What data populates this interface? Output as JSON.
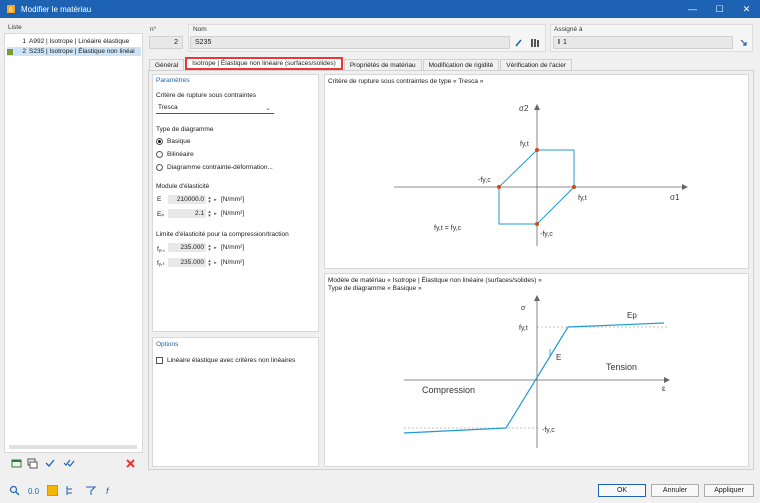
{
  "window": {
    "title": "Modifier le matériau",
    "minimize": "—",
    "maximize": "☐",
    "close": "✕"
  },
  "list": {
    "header": "Liste",
    "items": [
      {
        "num": "1",
        "label": "A992 | Isotrope | Linéaire élastique",
        "color": "#ffffff"
      },
      {
        "num": "2",
        "label": "S235 | Isotrope | Élastique non linéai",
        "color": "#7a9a3a"
      }
    ]
  },
  "header": {
    "num_label": "n°",
    "num_value": "2",
    "name_label": "Nom",
    "name_value": "S235",
    "assigned_label": "Assigné à",
    "assigned_value": "1"
  },
  "tabs": [
    {
      "label": "Général"
    },
    {
      "label": "Isotrope | Élastique non linéaire (surfaces/solides)"
    },
    {
      "label": "Propriétés de matériau"
    },
    {
      "label": "Modification de rigidité"
    },
    {
      "label": "Vérification de l'acier"
    }
  ],
  "params": {
    "title": "Paramètres",
    "criterion_label": "Critère de rupture sous contraintes",
    "criterion_value": "Tresca",
    "diagram_type_label": "Type de diagramme",
    "diagram_options": [
      "Basique",
      "Bilinéaire",
      "Diagramme contrainte-déformation..."
    ],
    "selected_option": "Basique",
    "elastic_modulus_label": "Module d'élasticité",
    "E_label": "E",
    "E_value": "210000.0",
    "E_unit": "[N/mm²]",
    "Ep_label": "Eₚ",
    "Ep_value": "2.1",
    "Ep_unit": "[N/mm²]",
    "yield_label": "Limite d'élasticité pour la compression/traction",
    "fyc_label": "fᵧ,꜀",
    "fyc_value": "235.000",
    "fyc_unit": "[N/mm²]",
    "fyt_label": "fᵧ,ₜ",
    "fyt_value": "235.000",
    "fyt_unit": "[N/mm²]"
  },
  "options": {
    "title": "Options",
    "checkbox_label": "Linéaire élastique avec critères non linéaires",
    "checked": false
  },
  "chart1": {
    "title": "Critère de rupture sous contraintes de type « Tresca »",
    "sigma2": "σ2",
    "sigma1": "σ1",
    "fyt_top": "fy,t",
    "fyc_left": "-fy,c",
    "fyt_right": "fy,t",
    "fyc_bottom": "-fy,c",
    "equation": "fy,t = fy,c"
  },
  "chart2": {
    "title_line1": "Modèle de matériau « Isotrope | Élastique non linéaire (surfaces/solides) »",
    "title_line2": "Type de diagramme « Basique »",
    "sigma": "σ",
    "epsilon": "ε",
    "fyt": "fy,t",
    "fyc": "-fy,c",
    "E": "E",
    "Ep": "Ep",
    "tension": "Tension",
    "compression": "Compression"
  },
  "buttons": {
    "ok": "OK",
    "cancel": "Annuler",
    "apply": "Appliquer"
  },
  "colors": {
    "accent": "#1e62b4",
    "highlight": "#e53935",
    "curve": "#1f9ad6",
    "point": "#d84315"
  }
}
